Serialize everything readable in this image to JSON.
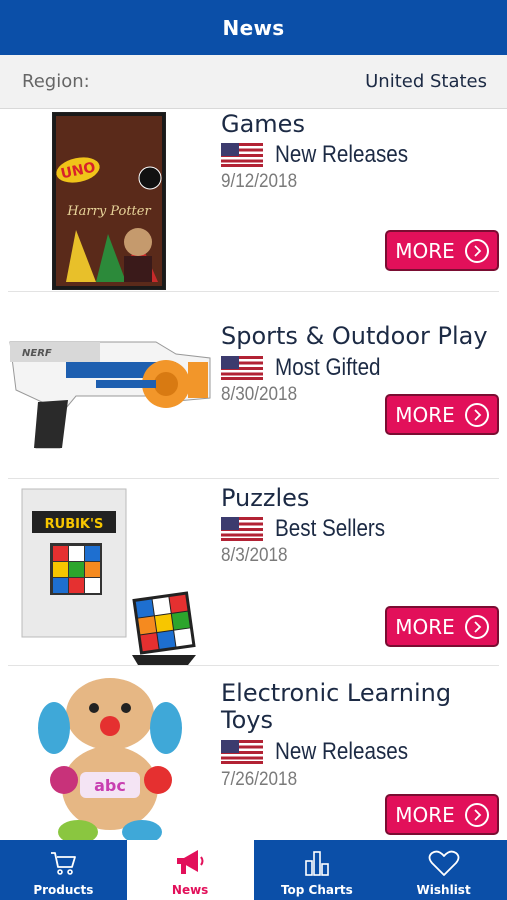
{
  "header": {
    "title": "News"
  },
  "region": {
    "label": "Region:",
    "value": "United States"
  },
  "items": [
    {
      "category": "Games",
      "list_type": "New Releases",
      "date": "9/12/2018",
      "more_label": "MORE",
      "image": "uno-harry-potter-cards",
      "card_text": "UNO",
      "card_subtitle": "Harry Potter"
    },
    {
      "category": "Sports & Outdoor Play",
      "list_type": "Most Gifted",
      "date": "8/30/2018",
      "more_label": "MORE",
      "image": "nerf-blaster",
      "brand_text": "NERF"
    },
    {
      "category": "Puzzles",
      "list_type": "Best Sellers",
      "date": "8/3/2018",
      "more_label": "MORE",
      "image": "rubiks-cube",
      "brand_text": "RUBIK'S"
    },
    {
      "category": "Electronic Learning Toys",
      "list_type": "New Releases",
      "date": "7/26/2018",
      "more_label": "MORE",
      "image": "learning-puppy-plush"
    }
  ],
  "tabs": [
    {
      "label": "Products",
      "icon": "cart-icon",
      "active": false
    },
    {
      "label": "News",
      "icon": "megaphone-icon",
      "active": true
    },
    {
      "label": "Top Charts",
      "icon": "bar-chart-icon",
      "active": false
    },
    {
      "label": "Wishlist",
      "icon": "heart-icon",
      "active": false
    }
  ],
  "colors": {
    "primary": "#0b4fa8",
    "accent": "#e2105a",
    "text": "#1c2a44"
  }
}
